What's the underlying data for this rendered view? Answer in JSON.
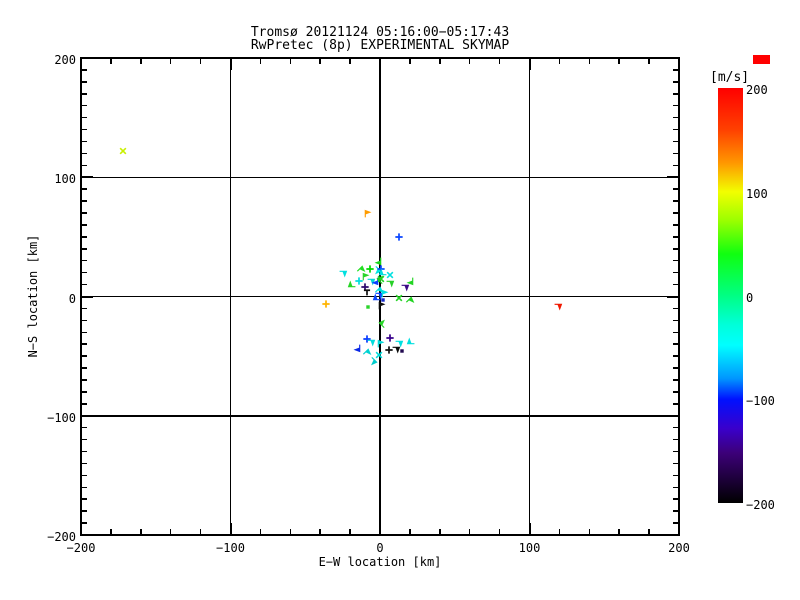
{
  "page": {
    "background": "#ffffff",
    "axis_color": "#000000"
  },
  "chart_data": {
    "type": "scatter",
    "title": "Tromsø 20121124 05:16:00−05:17:43",
    "subtitle": "RwPretec (8p) EXPERIMENTAL SKYMAP",
    "xlabel": "E−W location [km]",
    "ylabel": "N−S location [km]",
    "xlim": [
      -200,
      200
    ],
    "ylim": [
      -200,
      200
    ],
    "grid": true,
    "grid_lines": [
      -100,
      0,
      100
    ],
    "minor_tick_step_x": 20,
    "minor_tick_step_y": 10,
    "xticks": [
      {
        "v": -200,
        "label": "−200"
      },
      {
        "v": -100,
        "label": "−100"
      },
      {
        "v": 0,
        "label": "0"
      },
      {
        "v": 100,
        "label": "100"
      },
      {
        "v": 200,
        "label": "200"
      }
    ],
    "yticks": [
      {
        "v": 200,
        "label": "200"
      },
      {
        "v": 100,
        "label": "100"
      },
      {
        "v": 0,
        "label": "0"
      },
      {
        "v": -100,
        "label": "−100"
      },
      {
        "v": -200,
        "label": "−200"
      }
    ],
    "colorbar": {
      "label": "[m/s]",
      "min": -200,
      "max": 200,
      "ticks": [
        {
          "v": 200,
          "label": "200"
        },
        {
          "v": 100,
          "label": "100"
        },
        {
          "v": 0,
          "label": "0"
        },
        {
          "v": -100,
          "label": "−100"
        },
        {
          "v": -200,
          "label": "−200"
        }
      ],
      "gradient": [
        {
          "p": 0,
          "c": "#ff0000"
        },
        {
          "p": 10,
          "c": "#ff4000"
        },
        {
          "p": 18,
          "c": "#ff9700"
        },
        {
          "p": 25,
          "c": "#f2fe00"
        },
        {
          "p": 32,
          "c": "#9aff00"
        },
        {
          "p": 40,
          "c": "#10ff10"
        },
        {
          "p": 50,
          "c": "#00ff83"
        },
        {
          "p": 57,
          "c": "#00ffd9"
        },
        {
          "p": 62,
          "c": "#00ffff"
        },
        {
          "p": 70,
          "c": "#0096ff"
        },
        {
          "p": 75,
          "c": "#0011ff"
        },
        {
          "p": 82,
          "c": "#3a00cc"
        },
        {
          "p": 88,
          "c": "#3c0078"
        },
        {
          "p": 100,
          "c": "#000000"
        }
      ],
      "overflow_marker_color": "#ff0000"
    },
    "points": [
      {
        "x": -172,
        "y": 122,
        "v": 112,
        "c": "#c9f000",
        "g": "x",
        "r": 0
      },
      {
        "x": -9,
        "y": 69,
        "v": 140,
        "c": "#ff9c00",
        "g": "flag",
        "r": 0
      },
      {
        "x": 13,
        "y": 50,
        "v": -85,
        "c": "#0a46ff",
        "g": "plus",
        "r": 0
      },
      {
        "x": -36,
        "y": -6,
        "v": 128,
        "c": "#ffb400",
        "g": "plus",
        "r": 0
      },
      {
        "x": 119,
        "y": -8,
        "v": 192,
        "c": "#f01800",
        "g": "flag",
        "r": 90
      },
      {
        "x": -1,
        "y": 30,
        "v": 55,
        "c": "#19d619",
        "g": "flag",
        "r": 180
      },
      {
        "x": -25,
        "y": 20,
        "v": -35,
        "c": "#00e0e0",
        "g": "flag",
        "r": 90
      },
      {
        "x": -13,
        "y": 22,
        "v": 60,
        "c": "#22dd22",
        "g": "flag",
        "r": 45
      },
      {
        "x": -7,
        "y": 23,
        "v": 50,
        "c": "#00d900",
        "g": "plus",
        "r": 0
      },
      {
        "x": -2,
        "y": 22,
        "v": -40,
        "c": "#00e5e5",
        "g": "flag",
        "r": 135
      },
      {
        "x": 1,
        "y": 23,
        "v": -80,
        "c": "#0a50ff",
        "g": "plus",
        "r": 0
      },
      {
        "x": 2,
        "y": 20,
        "v": -30,
        "c": "#00dcdc",
        "g": "flag",
        "r": 270
      },
      {
        "x": 7,
        "y": 18,
        "v": -45,
        "c": "#00e0e0",
        "g": "x",
        "r": 0
      },
      {
        "x": -10,
        "y": 16,
        "v": 45,
        "c": "#2ad42a",
        "g": "flag",
        "r": 0
      },
      {
        "x": -14,
        "y": 13,
        "v": -38,
        "c": "#00dede",
        "g": "plus",
        "r": 0
      },
      {
        "x": -6,
        "y": 13,
        "v": -42,
        "c": "#00d8d8",
        "g": "flag",
        "r": 90
      },
      {
        "x": -3,
        "y": 13,
        "v": -90,
        "c": "#0a3cff",
        "g": "flag",
        "r": 180
      },
      {
        "x": 1,
        "y": 15,
        "v": 52,
        "c": "#1ed41e",
        "g": "x",
        "r": 0
      },
      {
        "x": -19,
        "y": 10,
        "v": 48,
        "c": "#26d626",
        "g": "flag",
        "r": 270
      },
      {
        "x": -10,
        "y": 8,
        "v": -165,
        "c": "#2e0a6e",
        "g": "plus",
        "r": 0
      },
      {
        "x": -9,
        "y": 4,
        "v": -195,
        "c": "#101010",
        "g": "tee",
        "r": 0
      },
      {
        "x": -1,
        "y": 5,
        "v": -35,
        "c": "#00dcdc",
        "g": "flag",
        "r": 45
      },
      {
        "x": -1,
        "y": 1,
        "v": -88,
        "c": "#0a46ff",
        "g": "flag",
        "r": 90
      },
      {
        "x": 3,
        "y": 2,
        "v": -40,
        "c": "#00e0e0",
        "g": "flag",
        "r": 0
      },
      {
        "x": 1,
        "y": 14,
        "v": 58,
        "c": "#1fd01f",
        "g": "flag",
        "r": 315
      },
      {
        "x": 7,
        "y": 11,
        "v": 47,
        "c": "#28d028",
        "g": "flag",
        "r": 90
      },
      {
        "x": 17,
        "y": 8,
        "v": -150,
        "c": "#3c0c86",
        "g": "flag",
        "r": 90
      },
      {
        "x": 21,
        "y": 13,
        "v": 50,
        "c": "#23d423",
        "g": "flag",
        "r": 180
      },
      {
        "x": 13,
        "y": -1,
        "v": 49,
        "c": "#23d423",
        "g": "x",
        "r": 0
      },
      {
        "x": -2,
        "y": -1,
        "v": -86,
        "c": "#0a46ff",
        "g": "flag",
        "r": 270
      },
      {
        "x": -8,
        "y": -9,
        "v": 46,
        "c": "#2ad42a",
        "g": "dot",
        "r": 0
      },
      {
        "x": 1,
        "y": -8,
        "v": -196,
        "c": "#0c0c0c",
        "g": "flag",
        "r": 0
      },
      {
        "x": 20,
        "y": -4,
        "v": 51,
        "c": "#20d320",
        "g": "flag",
        "r": 45
      },
      {
        "x": 2,
        "y": -3,
        "v": -120,
        "c": "#1428c8",
        "g": "dot",
        "r": 0
      },
      {
        "x": 2,
        "y": -23,
        "v": 47,
        "c": "#28d628",
        "g": "flag",
        "r": 315
      },
      {
        "x": -9,
        "y": -36,
        "v": -95,
        "c": "#0a3cff",
        "g": "plus",
        "r": 0
      },
      {
        "x": -6,
        "y": -38,
        "v": -40,
        "c": "#00dcdc",
        "g": "flag",
        "r": 90
      },
      {
        "x": -15,
        "y": -43,
        "v": -110,
        "c": "#0a28e6",
        "g": "flag",
        "r": 180
      },
      {
        "x": 7,
        "y": -35,
        "v": -155,
        "c": "#38008c",
        "g": "plus",
        "r": 0
      },
      {
        "x": 0,
        "y": -40,
        "v": -42,
        "c": "#00d8d8",
        "g": "flag",
        "r": 0
      },
      {
        "x": 13,
        "y": -39,
        "v": -38,
        "c": "#00e0e0",
        "g": "flag",
        "r": 90
      },
      {
        "x": 21,
        "y": -38,
        "v": -36,
        "c": "#00e0e0",
        "g": "flag",
        "r": 270
      },
      {
        "x": 6,
        "y": -45,
        "v": -192,
        "c": "#101010",
        "g": "plus",
        "r": 0
      },
      {
        "x": 11,
        "y": -44,
        "v": -198,
        "c": "#0a0a0a",
        "g": "flag",
        "r": 90
      },
      {
        "x": 15,
        "y": -46,
        "v": -170,
        "c": "#220a50",
        "g": "dot",
        "r": 0
      },
      {
        "x": -9,
        "y": -47,
        "v": -44,
        "c": "#00d2d2",
        "g": "flag",
        "r": 45
      },
      {
        "x": -1,
        "y": -49,
        "v": -41,
        "c": "#00dcdc",
        "g": "x",
        "r": 0
      },
      {
        "x": -5,
        "y": -54,
        "v": -46,
        "c": "#00cccc",
        "g": "flag",
        "r": 135
      }
    ]
  }
}
